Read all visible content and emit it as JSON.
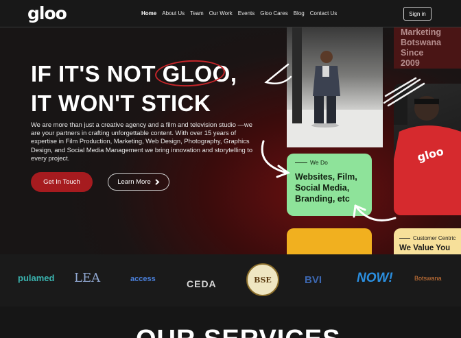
{
  "nav": {
    "logo": "gloo",
    "links": [
      "Home",
      "About Us",
      "Team",
      "Our Work",
      "Events",
      "Gloo Cares",
      "Blog",
      "Contact Us"
    ],
    "active": "Home",
    "signin_label": "Sign in"
  },
  "hero": {
    "headline_line1": "IF IT'S NOT GLOO,",
    "headline_line2": "IT WON'T STICK",
    "description": "We are more than just a creative agency and a film and television studio —we are your partners in crafting unforgettable content. With over 15 years of expertise in Film Production, Marketing, Web Design, Photography, Graphics Design, and Social Media Management we bring innovation and storytelling to every project.",
    "cta_primary": "Get In Touch",
    "cta_secondary": "Learn More",
    "accent_color": "#a61b1f"
  },
  "collage": {
    "marketing_lines": [
      "Marketing",
      "Botswana Since",
      "2009"
    ],
    "shirt_logo": "gloo",
    "we_do_label": "We Do",
    "we_do_lines": [
      "Websites, Film,",
      "Social Media,",
      "Branding, etc"
    ],
    "customer_label": "Customer Centric",
    "customer_text": "We Value You"
  },
  "partners": [
    "pulamed",
    "LEA",
    "access",
    "CEDA",
    "BSE",
    "BVI",
    "NOW!",
    "Botswana"
  ],
  "services_heading": "OUR SERVICES"
}
